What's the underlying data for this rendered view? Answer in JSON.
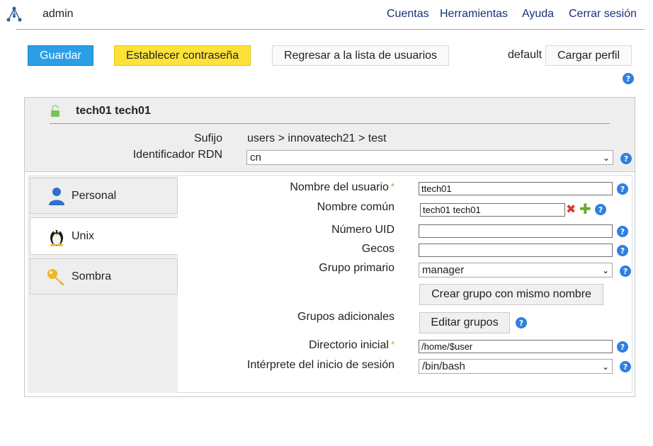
{
  "header": {
    "username": "admin",
    "nav": [
      "Cuentas",
      "Herramientas",
      "Ayuda",
      "Cerrar sesión"
    ]
  },
  "toolbar": {
    "save": "Guardar",
    "set_password": "Establecer contraseña",
    "back": "Regresar a la lista de usuarios",
    "profile_name": "default",
    "load_profile": "Cargar perfil"
  },
  "entry": {
    "title": "tech01 tech01",
    "suffix_label": "Sufijo",
    "suffix_value": "users > innovatech21 > test",
    "rdn_label": "Identificador RDN",
    "rdn_value": "cn"
  },
  "tabs": [
    {
      "label": "Personal",
      "icon": "user-icon"
    },
    {
      "label": "Unix",
      "icon": "penguin-icon",
      "active": true
    },
    {
      "label": "Sombra",
      "icon": "key-icon"
    }
  ],
  "form": {
    "username": {
      "label": "Nombre del usuario",
      "value": "ttech01"
    },
    "common_name": {
      "label": "Nombre común",
      "value": "tech01 tech01"
    },
    "uid": {
      "label": "Número UID",
      "value": ""
    },
    "gecos": {
      "label": "Gecos",
      "value": ""
    },
    "primary_group": {
      "label": "Grupo primario",
      "value": "manager"
    },
    "create_group_button": "Crear grupo con mismo nombre",
    "additional_groups": {
      "label": "Grupos adicionales",
      "button": "Editar grupos"
    },
    "home_dir": {
      "label": "Directorio inicial",
      "value": "/home/$user"
    },
    "shell": {
      "label": "Intérprete del inicio de sesión",
      "value": "/bin/bash"
    }
  },
  "colors": {
    "save": "#2c9ee5",
    "password": "#fde23a",
    "link": "#1a2f7a",
    "help": "#2f7fe0"
  }
}
